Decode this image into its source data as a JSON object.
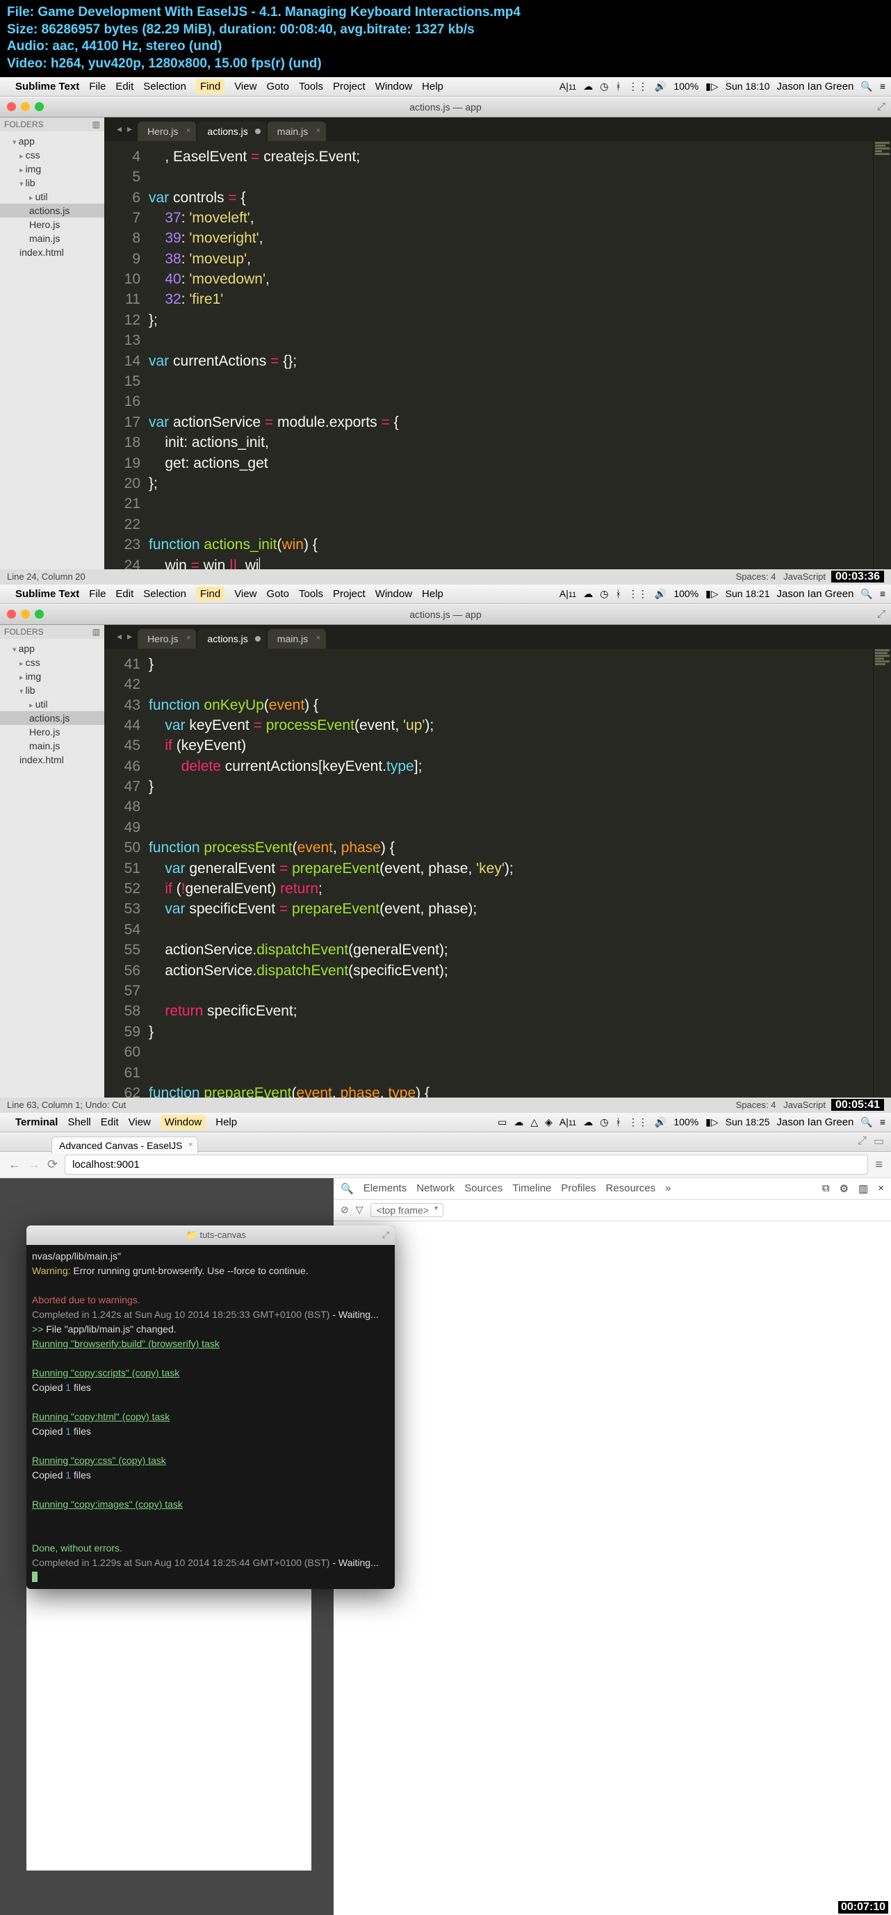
{
  "meta": {
    "file": "File: Game Development With EaselJS - 4.1. Managing Keyboard Interactions.mp4",
    "size": "Size: 86286957 bytes (82.29 MiB), duration: 00:08:40, avg.bitrate: 1327 kb/s",
    "audio": "Audio: aac, 44100 Hz, stereo (und)",
    "video": "Video: h264, yuv420p, 1280x800, 15.00 fps(r) (und)"
  },
  "menubar": {
    "app": "Sublime Text",
    "items": [
      "File",
      "Edit",
      "Selection",
      "Find",
      "View",
      "Goto",
      "Tools",
      "Project",
      "Window",
      "Help"
    ],
    "battery": "100%",
    "user": "Jason Ian Green",
    "badge": "11"
  },
  "window1": {
    "title": "actions.js — app",
    "time": "Sun 18:10",
    "sidebar_hdr": "FOLDERS",
    "sidebar": [
      {
        "t": "app",
        "cls": "open"
      },
      {
        "t": "css",
        "cls": "arrow d1"
      },
      {
        "t": "img",
        "cls": "arrow d1"
      },
      {
        "t": "lib",
        "cls": "open d1"
      },
      {
        "t": "util",
        "cls": "arrow d2"
      },
      {
        "t": "actions.js",
        "cls": "d2 sel"
      },
      {
        "t": "Hero.js",
        "cls": "d2"
      },
      {
        "t": "main.js",
        "cls": "d2"
      },
      {
        "t": "index.html",
        "cls": "d1"
      }
    ],
    "tabs": [
      {
        "label": "Hero.js",
        "active": false,
        "dirty": false
      },
      {
        "label": "actions.js",
        "active": true,
        "dirty": true
      },
      {
        "label": "main.js",
        "active": false,
        "dirty": false
      }
    ],
    "status_left": "Line 24, Column 20",
    "spaces": "Spaces: 4",
    "lang": "JavaScript",
    "ts": "00:03:36",
    "first_line": 4,
    "autocomplete": "win"
  },
  "window2": {
    "title": "actions.js — app",
    "time": "Sun 18:21",
    "status_left": "Line 63, Column 1; Undo: Cut",
    "first_line": 41,
    "ts": "00:05:41",
    "spaces": "Spaces: 4",
    "lang": "JavaScript"
  },
  "terminal_bar": {
    "app": "Terminal",
    "items": [
      "Shell",
      "Edit",
      "View",
      "Window",
      "Help"
    ],
    "time": "Sun 18:25"
  },
  "browser": {
    "tab": "Advanced Canvas - EaselJS",
    "url": "localhost:9001",
    "dt_tabs": [
      "Elements",
      "Network",
      "Sources",
      "Timeline",
      "Profiles",
      "Resources"
    ],
    "frame": "<top frame>",
    "prompt": ">"
  },
  "termwin": {
    "title": "tuts-canvas",
    "l1": "nvas/app/lib/main.js\"",
    "l2a": "Warning:",
    "l2b": " Error running grunt-browserify. Use --force to continue.",
    "l3": "Aborted due to warnings.",
    "l4a": "Completed in 1.242s at Sun Aug 10 2014 18:25:33 GMT+0100 (BST)",
    "l4b": " - Waiting...",
    "l5a": ">> ",
    "l5b": "File \"app/lib/main.js\" changed.",
    "l6": "Running \"browserify:build\" (browserify) task",
    "l7": "Running \"copy:scripts\" (copy) task",
    "l8a": "Copied ",
    "l8b": "1",
    "l8c": " files",
    "l9": "Running \"copy:html\" (copy) task",
    "l10": "Running \"copy:css\" (copy) task",
    "l11": "Running \"copy:images\" (copy) task",
    "l12": "Done, without errors.",
    "l13a": "Completed in 1.229s at Sun Aug 10 2014 18:25:44 GMT+0100 (BST)",
    "l13b": " - Waiting..."
  },
  "final_ts": "00:07:10"
}
